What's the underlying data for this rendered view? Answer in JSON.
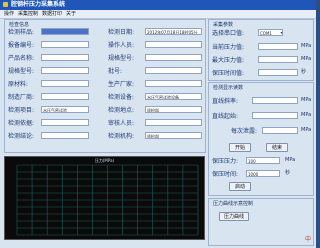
{
  "window": {
    "title": "腔钢杆压力采集系统"
  },
  "menu": [
    "操作",
    "采集控制",
    "数据打印",
    "关于"
  ],
  "info": {
    "title": "检查信息",
    "rows": [
      {
        "left_label": "检测样品:",
        "left_value": "",
        "right_label": "检测日期:",
        "right_value": "2012年07月18日18时05分"
      },
      {
        "left_label": "报备编号:",
        "left_value": "",
        "right_label": "操作人员:",
        "right_value": ""
      },
      {
        "left_label": "产品名称:",
        "left_value": "",
        "right_label": "规格型号:",
        "right_value": ""
      },
      {
        "left_label": "规格型号:",
        "left_value": "",
        "right_label": "批号:",
        "right_value": ""
      },
      {
        "left_label": "原材料:",
        "left_value": "",
        "right_label": "生产厂家:",
        "right_value": ""
      },
      {
        "left_label": "制造厂商:",
        "left_value": "",
        "right_label": "检测设备:",
        "right_value": "水压气密试验设备"
      },
      {
        "left_label": "检测项目:",
        "left_value": "水压气密试验",
        "right_label": "检测地点:",
        "right_value": "质检部"
      },
      {
        "left_label": "检测依据:",
        "left_value": "",
        "right_label": "审核人员:",
        "right_value": ""
      },
      {
        "left_label": "检测结论:",
        "left_value": "",
        "right_label": "检测机构:",
        "right_value": "质检部"
      }
    ]
  },
  "params": {
    "title": "采集参数",
    "port_label": "选择串口值:",
    "port_value": "COM1",
    "rows": [
      {
        "label": "当前压力值:",
        "value": "",
        "unit": "MPa"
      },
      {
        "label": "最大压力值:",
        "value": "",
        "unit": "MPa"
      },
      {
        "label": "保压时间值:",
        "value": "",
        "unit": "秒"
      }
    ]
  },
  "verify": {
    "title": "检测显示读数",
    "rows": [
      {
        "label": "直线斜率:",
        "value": "",
        "unit": "MPa"
      },
      {
        "label": "直线起始:",
        "value": "",
        "unit": "MPa"
      },
      {
        "label": "每次泄露:",
        "value": "",
        "unit": "MPa"
      }
    ],
    "start_label": "开始",
    "stop_label": "结束",
    "pressure_label": "保压压力:",
    "pressure_value": "100",
    "pressure_unit": "MPa",
    "time_label": "保压时间:",
    "time_value": "1000",
    "time_unit": "秒",
    "launch_label": "启动"
  },
  "control": {
    "title": "压力曲线示意控制",
    "button_label": "压力曲线"
  },
  "chart_data": {
    "type": "line",
    "title": "压力(MPa)",
    "series": []
  },
  "logo": {
    "text": "中"
  }
}
